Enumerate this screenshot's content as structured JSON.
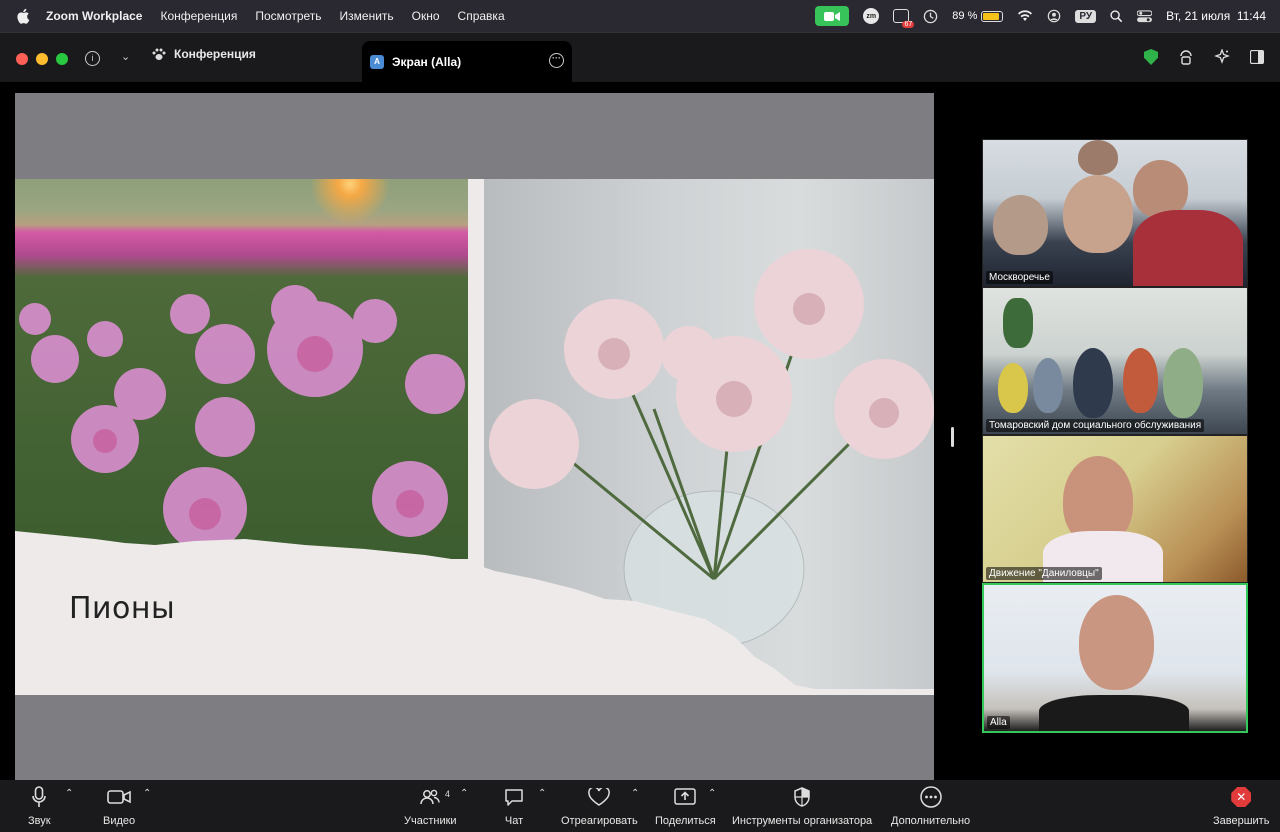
{
  "menubar": {
    "app_name": "Zoom Workplace",
    "items": [
      "Конференция",
      "Посмотреть",
      "Изменить",
      "Окно",
      "Справка"
    ],
    "battery_percent": "89 %",
    "battery_level": 0.89,
    "badge_count": "67",
    "zm_label": "zm",
    "language": "РУ",
    "datetime": "Вт, 21 июля  11:44"
  },
  "titlebar": {
    "conference_tab": "Конференция",
    "screen_tab": "Экран (Alla)",
    "screen_tab_avatar": "A"
  },
  "slide": {
    "title": "Пионы"
  },
  "participants": [
    {
      "name": "Москворечье"
    },
    {
      "name": "Томаровский дом социального обслуживания"
    },
    {
      "name": "Движение \"Даниловцы\""
    },
    {
      "name": "Alla"
    }
  ],
  "toolbar": {
    "audio": "Звук",
    "video": "Видео",
    "participants": "Участники",
    "participants_count": "4",
    "chat": "Чат",
    "react": "Отреагировать",
    "share": "Поделиться",
    "host_tools": "Инструменты организатора",
    "more": "Дополнительно",
    "end": "Завершить"
  },
  "colors": {
    "accent_green": "#34c759",
    "end_red": "#e23b3b",
    "battery_yellow": "#f4c21b"
  }
}
